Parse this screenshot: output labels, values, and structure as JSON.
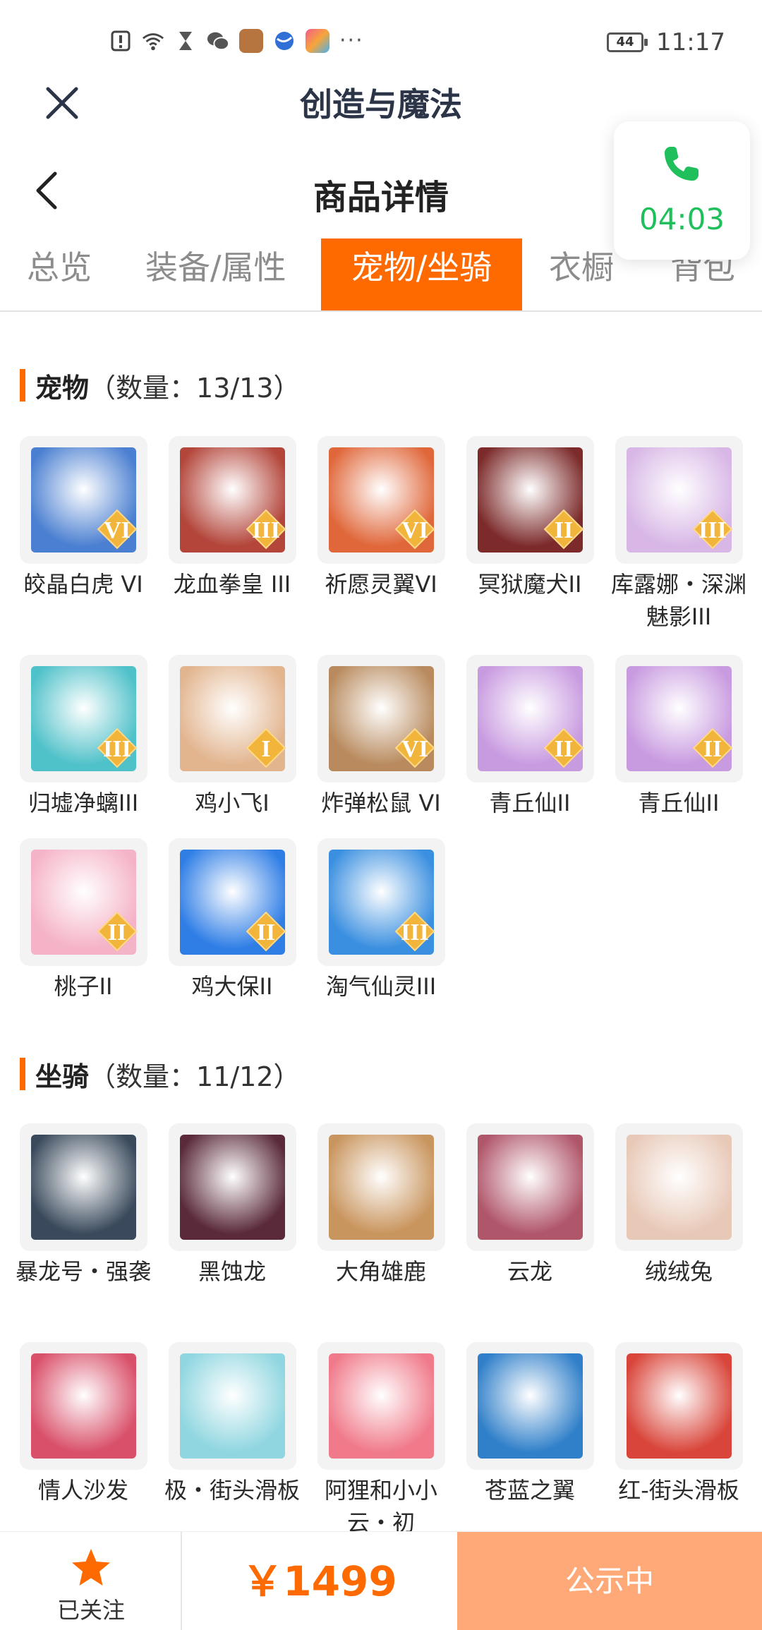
{
  "status_bar": {
    "time": "11:17",
    "battery": "44",
    "more": "···"
  },
  "header": {
    "app_title": "创造与魔法",
    "page_title": "商品详情"
  },
  "call": {
    "timer": "04:03"
  },
  "tabs": [
    {
      "label": "总览"
    },
    {
      "label": "装备/属性"
    },
    {
      "label": "宠物/坐骑",
      "active": true
    },
    {
      "label": "衣橱"
    },
    {
      "label": "背包"
    }
  ],
  "pets": {
    "title": "宠物",
    "count": "（数量：13/13）",
    "items": [
      {
        "name": "皎晶白虎 VI",
        "level": "VI",
        "color": "#4a7fd1"
      },
      {
        "name": "龙血拳皇 III",
        "level": "III",
        "color": "#b3453a"
      },
      {
        "name": "祈愿灵翼VI",
        "level": "VI",
        "color": "#e0673a"
      },
      {
        "name": "冥狱魔犬II",
        "level": "II",
        "color": "#7c2a2a"
      },
      {
        "name": "库露娜・深渊魅影III",
        "level": "III",
        "color": "#d8b7e6"
      },
      {
        "name": "归墟净螭III",
        "level": "III",
        "color": "#4fc1c9"
      },
      {
        "name": "鸡小飞I",
        "level": "I",
        "color": "#e2b58f"
      },
      {
        "name": "炸弹松鼠 VI",
        "level": "VI",
        "color": "#b88a5d"
      },
      {
        "name": "青丘仙II",
        "level": "II",
        "color": "#c89ae0"
      },
      {
        "name": "青丘仙II",
        "level": "II",
        "color": "#c89ae0"
      },
      {
        "name": "桃子II",
        "level": "II",
        "color": "#f5b3c7"
      },
      {
        "name": "鸡大保II",
        "level": "II",
        "color": "#2f7ee6"
      },
      {
        "name": "淘气仙灵III",
        "level": "III",
        "color": "#3a8fe0"
      }
    ]
  },
  "mounts": {
    "title": "坐骑",
    "count": "（数量：11/12）",
    "items": [
      {
        "name": "暴龙号・强袭",
        "color": "#3a4a5c"
      },
      {
        "name": "黑蚀龙",
        "color": "#5a2a3a"
      },
      {
        "name": "大角雄鹿",
        "color": "#c9955e"
      },
      {
        "name": "云龙",
        "color": "#b0566a"
      },
      {
        "name": "绒绒兔",
        "color": "#e8c9b8"
      },
      {
        "name": "情人沙发",
        "color": "#d9506a"
      },
      {
        "name": "极・街头滑板",
        "color": "#8fd6e0"
      },
      {
        "name": "阿狸和小小云・初",
        "color": "#f07a8a"
      },
      {
        "name": "苍蓝之翼",
        "color": "#2f7fc9"
      },
      {
        "name": "红-街头滑板",
        "color": "#d9453a"
      }
    ]
  },
  "bottom": {
    "follow_label": "已关注",
    "price": "￥1499",
    "status": "公示中"
  }
}
